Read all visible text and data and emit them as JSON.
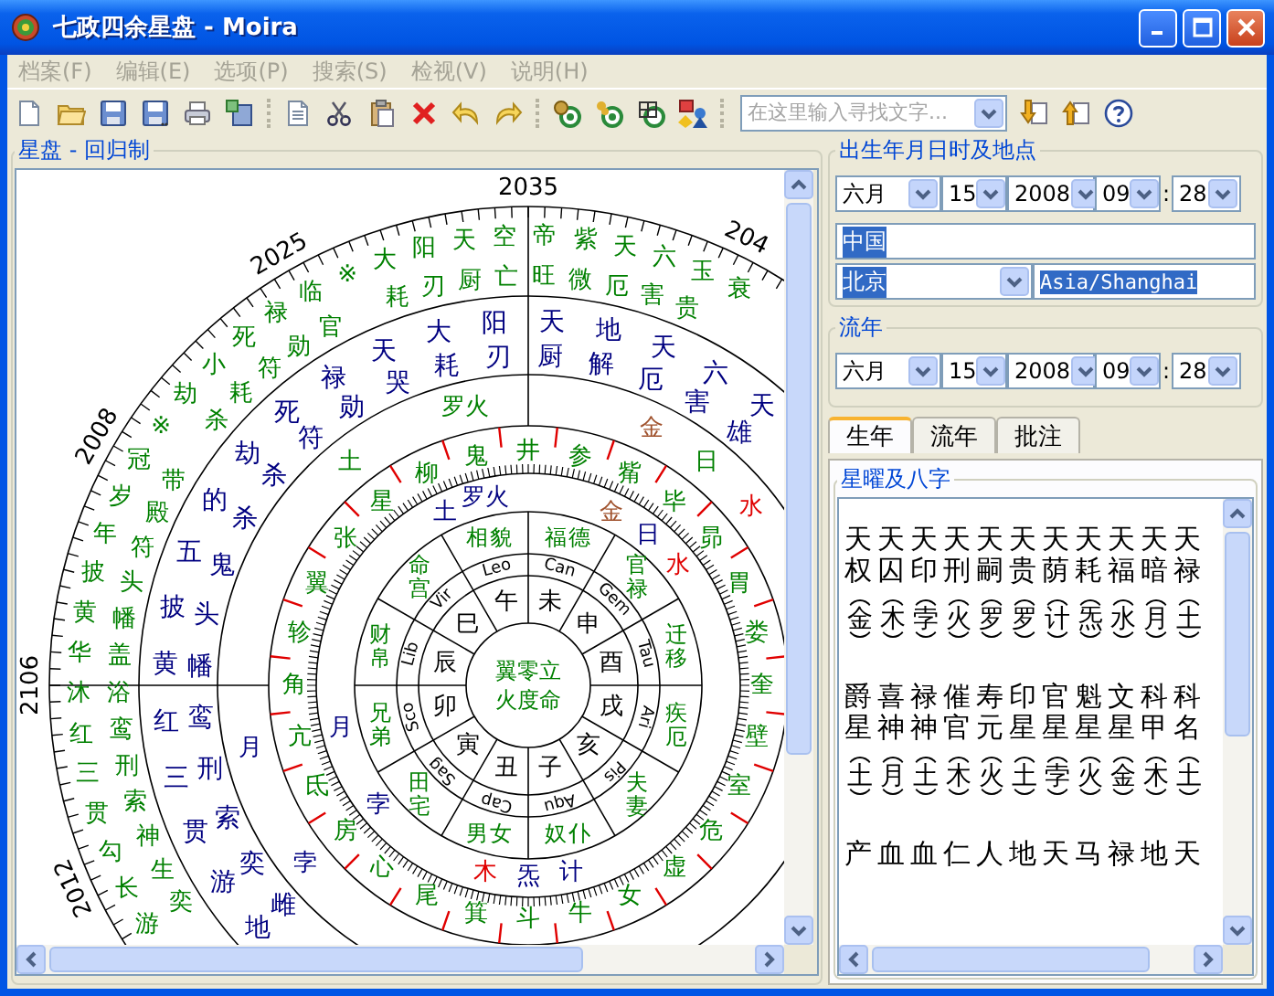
{
  "window": {
    "title": "七政四余星盘 - Moira"
  },
  "menu": [
    {
      "label": "档案(F)",
      "disabled": true
    },
    {
      "label": "编辑(E)",
      "disabled": true
    },
    {
      "label": "选项(P)",
      "disabled": true
    },
    {
      "label": "搜索(S)",
      "disabled": true
    },
    {
      "label": "检视(V)",
      "disabled": true
    },
    {
      "label": "说明(H)",
      "disabled": true
    }
  ],
  "toolbar": {
    "search": {
      "placeholder": "在这里输入寻找文字..."
    }
  },
  "chart_panel": {
    "title": "星盘 - 回归制",
    "wheel": {
      "age_labels": [
        "2035",
        "204",
        "2025",
        "2008",
        "2106",
        "2012"
      ],
      "outer_ring": {
        "top": [
          "小耗",
          "死符",
          "禄勋",
          "临官",
          "※",
          "大耗",
          "阳刃",
          "天厨",
          "空亡",
          "帝旺",
          "紫微",
          "天厄",
          "六害",
          "玉贵",
          "衰"
        ],
        "left": [
          "劫杀",
          "※",
          "冠带",
          "岁殿",
          "年符",
          "披头",
          "黄幡",
          "华盖",
          "沐浴",
          "红鸾",
          "三刑",
          "贯索",
          "勾神",
          "长生",
          "游奕"
        ]
      },
      "inner_ring": {
        "top": [
          "死符",
          "禄勋",
          "天哭",
          "大耗",
          "阳刃",
          "天厨",
          "地解",
          "天厄",
          "六害",
          "天雄"
        ],
        "left": [
          "劫杀",
          "的杀",
          "五鬼",
          "披头",
          "黄幡",
          "红鸾",
          "三刑",
          "贯索",
          "游奕",
          "地雌"
        ]
      },
      "mansions": {
        "top": [
          {
            "name": "星",
            "outer_planets": [
              {
                "text": "土",
                "color": "#008000"
              }
            ]
          },
          {
            "name": "柳",
            "inner_planets": [
              {
                "text": "土",
                "color": "#000080"
              }
            ]
          },
          {
            "name": "鬼",
            "outer_planets": [
              {
                "text": "罗火",
                "color": "#008000"
              }
            ],
            "inner_planets": [
              {
                "text": "罗火",
                "color": "#000080"
              }
            ]
          },
          {
            "name": "井"
          },
          {
            "name": "参"
          },
          {
            "name": "觜",
            "outer_planets": [
              {
                "text": "金",
                "color": "#a0522d"
              }
            ],
            "inner_planets": [
              {
                "text": "金",
                "color": "#a0522d"
              }
            ]
          },
          {
            "name": "毕",
            "outer_planets": [
              {
                "text": "日",
                "color": "#008000"
              }
            ],
            "inner_planets": [
              {
                "text": "日",
                "color": "#000080"
              }
            ]
          }
        ],
        "right": [
          {
            "name": "昴",
            "outer_planets": [
              {
                "text": "水",
                "color": "#e00000"
              }
            ],
            "inner_planets": [
              {
                "text": "水",
                "color": "#e00000"
              }
            ]
          },
          {
            "name": "胃"
          },
          {
            "name": "娄"
          },
          {
            "name": "奎"
          },
          {
            "name": "壁"
          },
          {
            "name": "室"
          },
          {
            "name": "危"
          }
        ],
        "bottom": [
          {
            "name": "心"
          },
          {
            "name": "尾"
          },
          {
            "name": "箕",
            "inner_planets": [
              {
                "text": "木",
                "color": "#e00000"
              }
            ]
          },
          {
            "name": "斗",
            "inner_planets": [
              {
                "text": "炁",
                "color": "#000080"
              }
            ]
          },
          {
            "name": "牛",
            "inner_planets": [
              {
                "text": "计",
                "color": "#000080"
              }
            ]
          },
          {
            "name": "女"
          },
          {
            "name": "虚"
          }
        ],
        "left": [
          {
            "name": "张"
          },
          {
            "name": "翼"
          },
          {
            "name": "轸"
          },
          {
            "name": "角"
          },
          {
            "name": "亢",
            "outer_planets": [
              {
                "text": "月",
                "color": "#000080"
              }
            ],
            "inner_planets": [
              {
                "text": "月",
                "color": "#000080"
              }
            ]
          },
          {
            "name": "氐"
          },
          {
            "name": "房",
            "outer_planets": [
              {
                "text": "孛",
                "color": "#000080"
              }
            ],
            "inner_planets": [
              {
                "text": "孛",
                "color": "#000080"
              }
            ]
          }
        ]
      },
      "houses": [
        "命宫",
        "财帛",
        "兄弟",
        "田宅",
        "男女",
        "奴仆",
        "夫妻",
        "疾厄",
        "迁移",
        "官禄",
        "福德",
        "相貌"
      ],
      "signs": [
        "Vir",
        "Lib",
        "Sco",
        "Sag",
        "Cap",
        "Aqu",
        "Pis",
        "Ari",
        "Tau",
        "Gem",
        "Can",
        "Leo"
      ],
      "branches": [
        "巳",
        "辰",
        "卯",
        "寅",
        "丑",
        "子",
        "亥",
        "戌",
        "酉",
        "申",
        "未",
        "午"
      ],
      "center": [
        "翼零立",
        "火度命"
      ]
    }
  },
  "birth": {
    "title": "出生年月日时及地点",
    "date": {
      "month": "六月",
      "day": "15",
      "year": "2008",
      "hour": "09",
      "separator": ":",
      "minute": "28"
    },
    "country": {
      "value": "中国",
      "highlighted": true
    },
    "city": {
      "value": "北京",
      "highlighted": true
    },
    "timezone": {
      "value": "Asia/Shanghai",
      "highlighted": true
    }
  },
  "transit": {
    "title": "流年",
    "date": {
      "month": "六月",
      "day": "15",
      "year": "2008",
      "hour": "09",
      "separator": ":",
      "minute": "28"
    }
  },
  "tabs": [
    {
      "label": "生年",
      "selected": true
    },
    {
      "label": "流年",
      "selected": false
    },
    {
      "label": "批注",
      "selected": false
    }
  ],
  "stars_panel": {
    "title": "星曜及八字",
    "groups": [
      {
        "stars": [
          {
            "name": "天权",
            "planet": "金"
          },
          {
            "name": "天囚",
            "planet": "木"
          },
          {
            "name": "天印",
            "planet": "孛"
          },
          {
            "name": "天刑",
            "planet": "火"
          },
          {
            "name": "天嗣",
            "planet": "罗"
          },
          {
            "name": "天贵",
            "planet": "罗"
          },
          {
            "name": "天荫",
            "planet": "计"
          },
          {
            "name": "天耗",
            "planet": "炁"
          },
          {
            "name": "天福",
            "planet": "水"
          },
          {
            "name": "天暗",
            "planet": "月"
          },
          {
            "name": "天禄",
            "planet": "土"
          }
        ]
      },
      {
        "stars": [
          {
            "name": "爵星",
            "planet": "土"
          },
          {
            "name": "喜神",
            "planet": "月"
          },
          {
            "name": "禄神",
            "planet": "土"
          },
          {
            "name": "催官",
            "planet": "木"
          },
          {
            "name": "寿元",
            "planet": "火"
          },
          {
            "name": "印星",
            "planet": "土"
          },
          {
            "name": "官星",
            "planet": "孛"
          },
          {
            "name": "魁星",
            "planet": "火"
          },
          {
            "name": "文星",
            "planet": "金"
          },
          {
            "name": "科甲",
            "planet": "木"
          },
          {
            "name": "科名",
            "planet": "土"
          }
        ]
      },
      {
        "stars": [
          {
            "name": "产"
          },
          {
            "name": "血"
          },
          {
            "name": "血"
          },
          {
            "name": "仁"
          },
          {
            "name": "人"
          },
          {
            "name": "地"
          },
          {
            "name": "天"
          },
          {
            "name": "马"
          },
          {
            "name": "禄"
          },
          {
            "name": "地"
          },
          {
            "name": "天"
          }
        ]
      }
    ]
  }
}
